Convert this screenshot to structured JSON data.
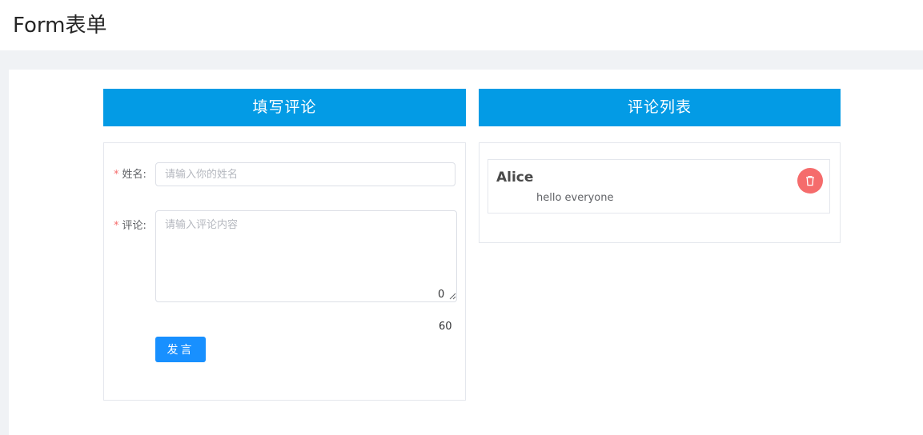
{
  "header": {
    "title": "Form表单"
  },
  "form_panel": {
    "title": "填写评论",
    "name_label": "姓名:",
    "name_required_mark": "*",
    "name_placeholder": "请输入你的姓名",
    "name_value": "",
    "comment_label": "评论:",
    "comment_required_mark": "*",
    "comment_placeholder": "请输入评论内容",
    "comment_value": "",
    "char_count": "0",
    "max_length": "60",
    "submit_label": "发言"
  },
  "list_panel": {
    "title": "评论列表",
    "comments": [
      {
        "author": "Alice",
        "text": "hello everyone",
        "delete_icon": "trash-icon"
      }
    ]
  },
  "colors": {
    "header_bg": "#039be5",
    "primary_button": "#1890ff",
    "danger_button": "#f56c6c",
    "required": "#f56c6c",
    "page_gray": "#f0f2f5"
  }
}
